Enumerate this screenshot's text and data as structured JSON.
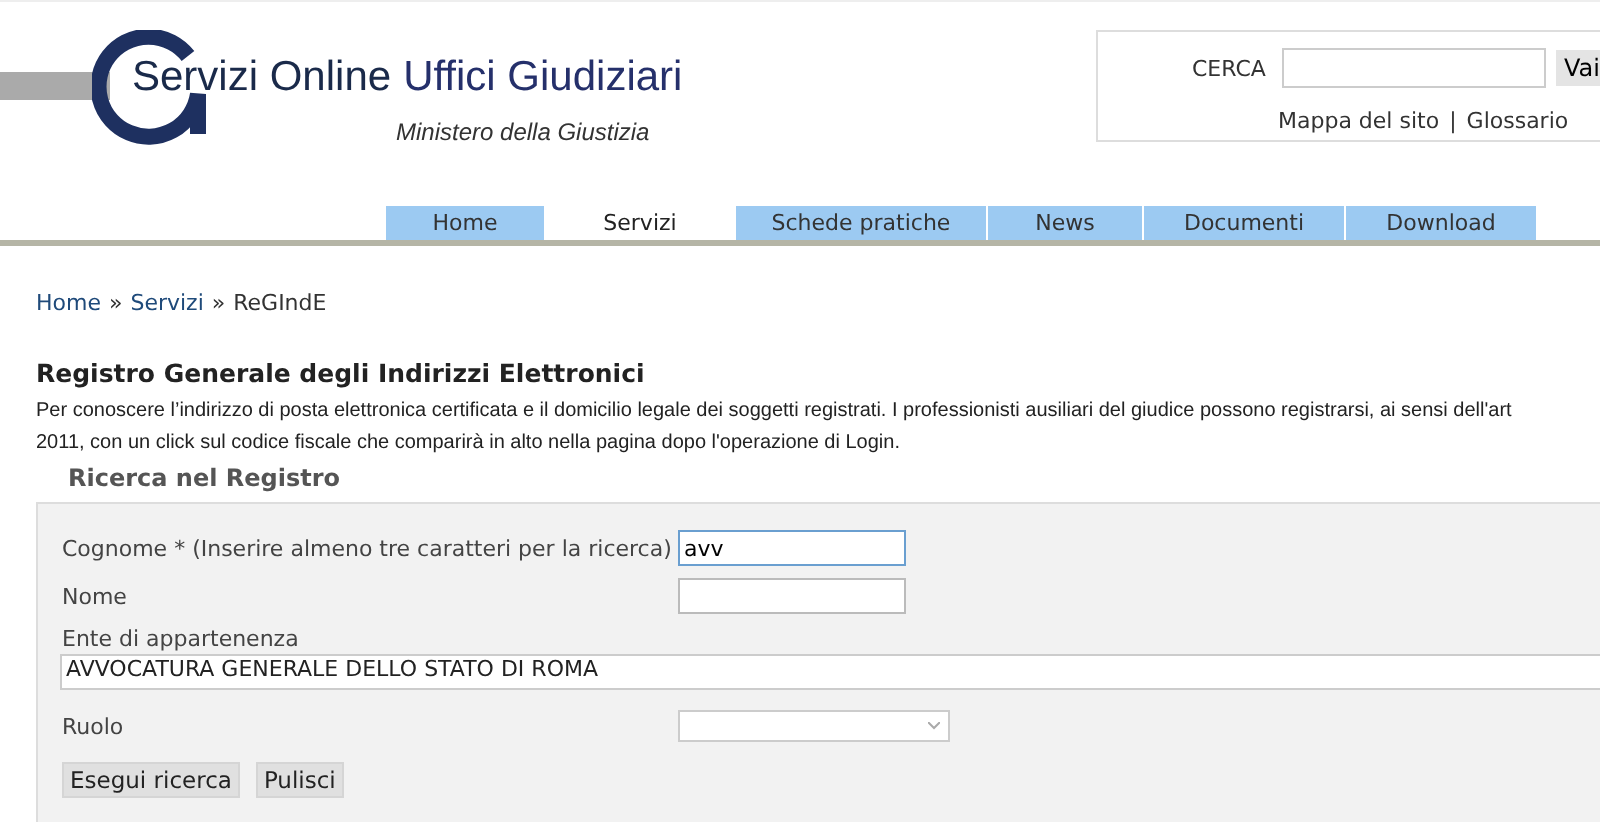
{
  "header": {
    "logo_title": [
      "Servizi Online",
      "Uffici Giudiziari"
    ],
    "logo_subtitle": "Ministero della Giustizia",
    "search": {
      "label": "CERCA",
      "button": "Vai"
    },
    "links": [
      {
        "label": "Mappa del sito"
      },
      {
        "label": "Glossario"
      }
    ],
    "link_separator": "|"
  },
  "tabs": [
    {
      "label": "Home",
      "selected": false
    },
    {
      "label": "Servizi",
      "selected": true
    },
    {
      "label": "Schede pratiche",
      "selected": false
    },
    {
      "label": "News",
      "selected": false
    },
    {
      "label": "Documenti",
      "selected": false
    },
    {
      "label": "Download",
      "selected": false
    }
  ],
  "breadcrumb": {
    "items": [
      {
        "label": "Home",
        "link": true
      },
      {
        "label": "Servizi",
        "link": true
      },
      {
        "label": "ReGIndE",
        "link": false
      }
    ],
    "separator": "»"
  },
  "page": {
    "title": "Registro Generale degli Indirizzi Elettronici",
    "intro": [
      "Per conoscere l’indirizzo di posta elettronica certificata e il domicilio legale dei soggetti registrati. I professionisti ausiliari del giudice possono registrarsi, ai sensi dell'art",
      "2011, con un click sul codice fiscale che comparirà in alto nella pagina dopo l'operazione di Login."
    ],
    "section": "Ricerca nel Registro"
  },
  "form": {
    "fields": [
      {
        "kind": "text",
        "label": "Cognome * (Inserire almeno tre caratteri per la ricerca)",
        "value": "avv",
        "focused": true
      },
      {
        "kind": "text",
        "label": "Nome",
        "focused": false
      },
      {
        "kind": "wide",
        "label": "Ente di appartenenza",
        "value": "AVVOCATURA GENERALE DELLO STATO DI ROMA"
      },
      {
        "kind": "select",
        "label": "Ruolo"
      }
    ],
    "buttons": [
      "Esegui ricerca",
      "Pulisci"
    ]
  }
}
